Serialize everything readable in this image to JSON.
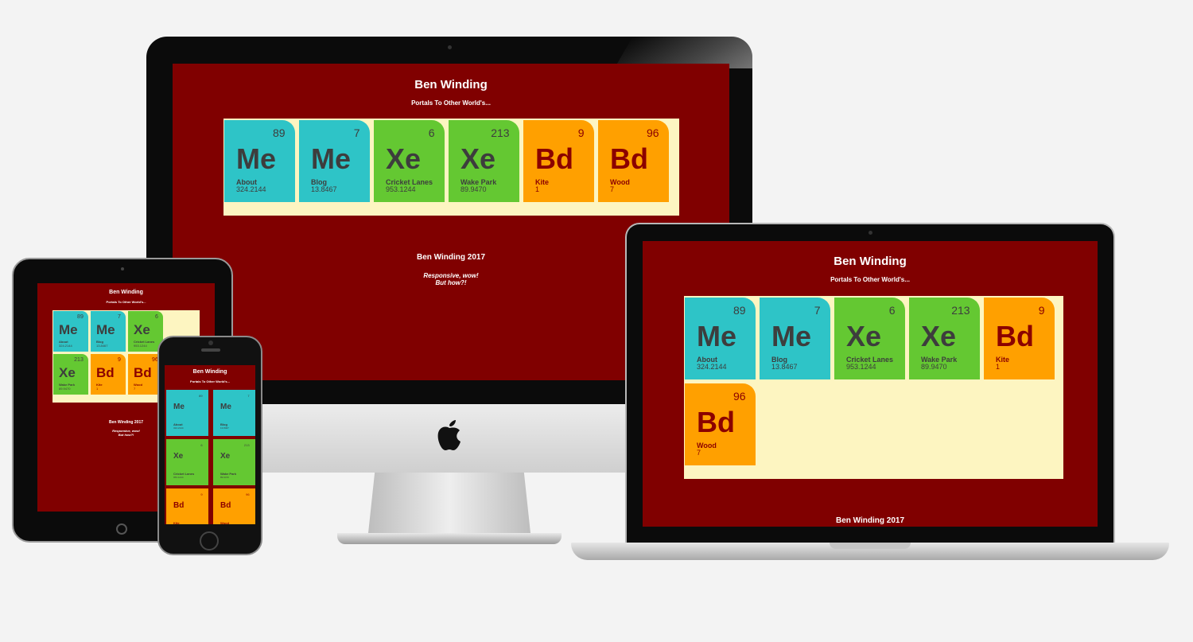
{
  "site": {
    "title": "Ben Winding",
    "subtitle": "Portals To Other World's...",
    "footer_title": "Ben Winding 2017",
    "footer_line1": "Responsive, wow!",
    "footer_line2": "But how?!"
  },
  "tiles": [
    {
      "number": "89",
      "symbol": "Me",
      "name": "About",
      "value": "324.2144",
      "color": "#2ec4c7"
    },
    {
      "number": "7",
      "symbol": "Me",
      "name": "Blog",
      "value": "13.8467",
      "color": "#2ec4c7"
    },
    {
      "number": "6",
      "symbol": "Xe",
      "name": "Cricket Lanes",
      "value": "953.1244",
      "color": "#64c832"
    },
    {
      "number": "213",
      "symbol": "Xe",
      "name": "Wake Park",
      "value": "89.9470",
      "color": "#64c832"
    },
    {
      "number": "9",
      "symbol": "Bd",
      "name": "Kite",
      "value": "1",
      "color": "#ffa000"
    },
    {
      "number": "96",
      "symbol": "Bd",
      "name": "Wood",
      "value": "7",
      "color": "#ffa000"
    }
  ],
  "colors": {
    "page_background": "#800000",
    "table_background": "#fdf5c1",
    "teal": "#2ec4c7",
    "green": "#64c832",
    "orange": "#ffa000"
  }
}
